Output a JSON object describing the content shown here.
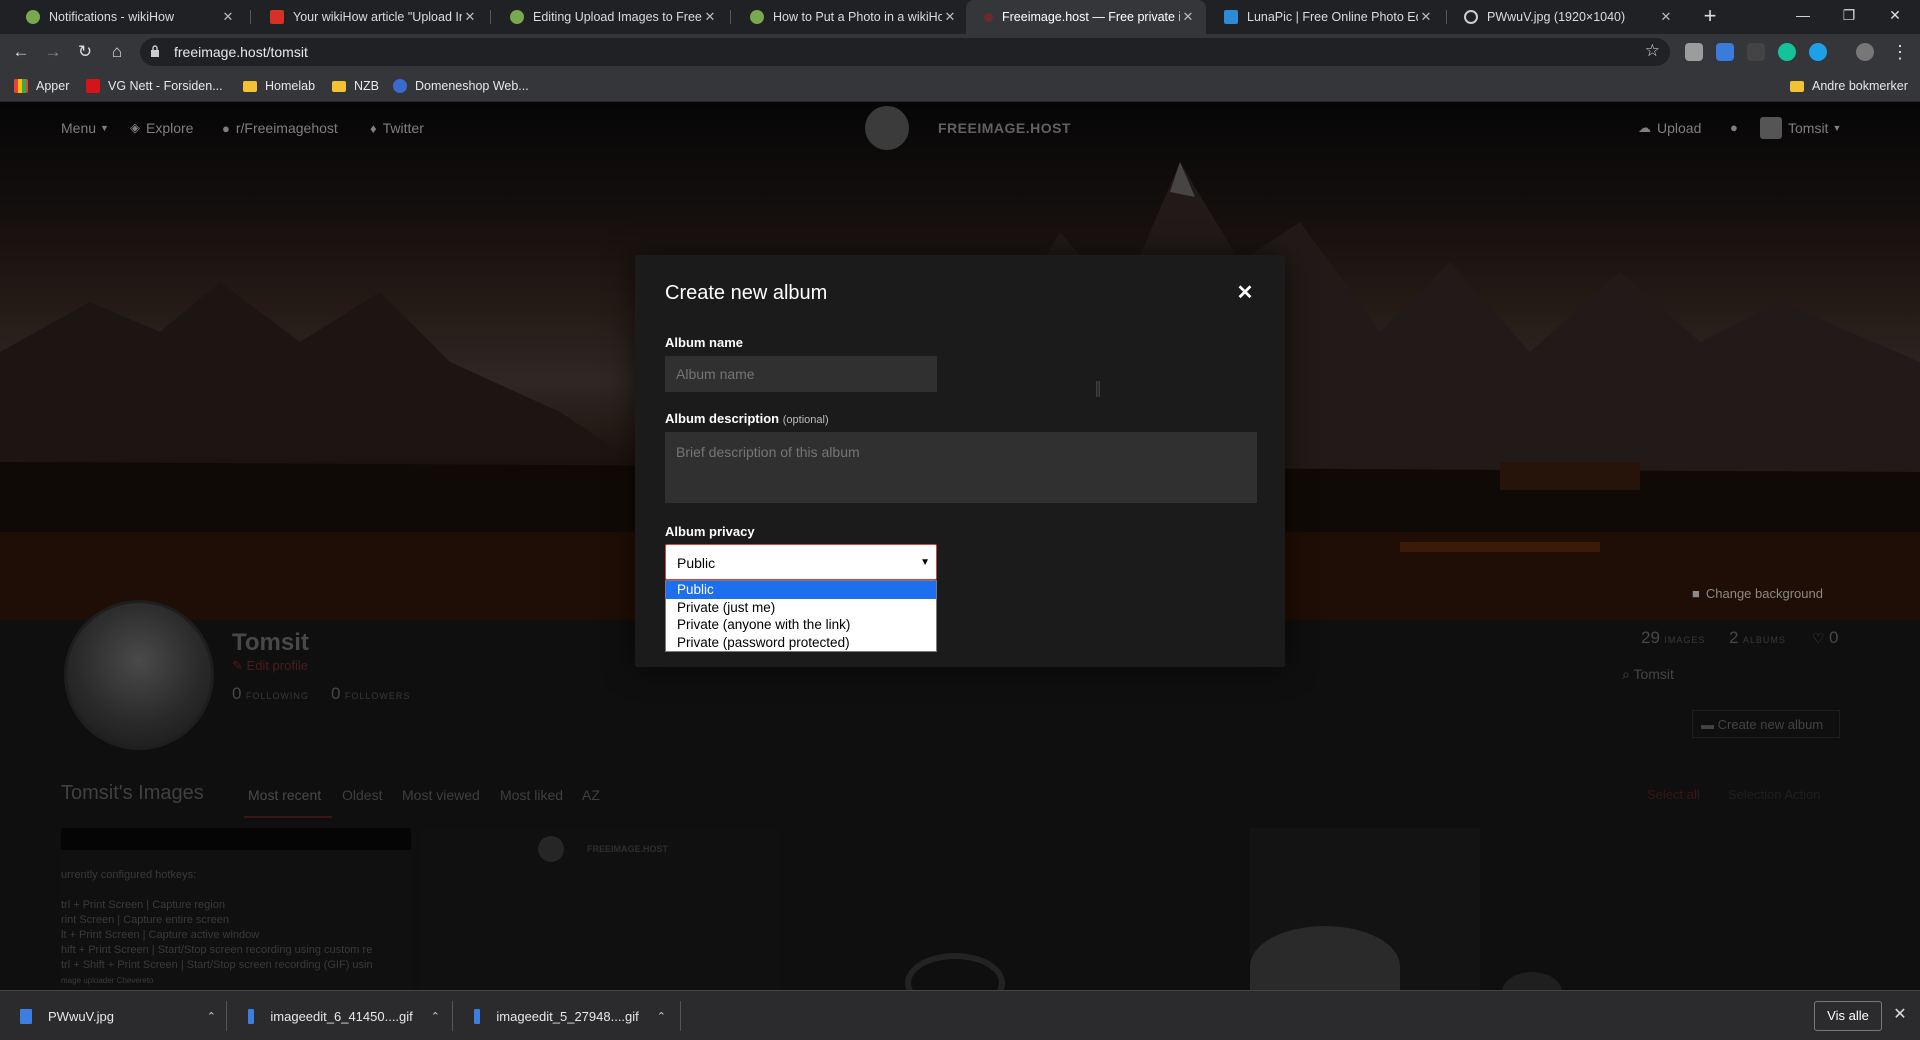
{
  "browser": {
    "tabs": [
      {
        "title": "Notifications - wikiHow",
        "favicon": "wikihow-icon",
        "active": false
      },
      {
        "title": "Your wikiHow article \"Upload Ima",
        "favicon": "gmail-icon",
        "active": false
      },
      {
        "title": "Editing Upload Images to Freeim",
        "favicon": "wikihow-icon",
        "active": false
      },
      {
        "title": "How to Put a Photo in a wikiHow",
        "favicon": "wikihow-icon",
        "active": false
      },
      {
        "title": "Freeimage.host — Free private im",
        "favicon": "freeimage-icon",
        "active": true
      },
      {
        "title": "LunaPic | Free Online Photo Edito",
        "favicon": "lunapic-icon",
        "active": false
      },
      {
        "title": "PWwuV.jpg (1920×1040)",
        "favicon": "globe-icon",
        "active": false
      }
    ],
    "address": "freeimage.host/tomsit",
    "bookmarks": [
      "Apper",
      "VG Nett - Forsiden...",
      "Homelab",
      "NZB",
      "Domeneshop Web..."
    ],
    "other_bookmarks": "Andre bokmerker"
  },
  "site": {
    "nav": {
      "menu": "Menu",
      "explore": "Explore",
      "reddit": "r/Freeimagehost",
      "twitter": "Twitter",
      "upload": "Upload",
      "user": "Tomsit"
    },
    "brand": "FREEIMAGE.HOST",
    "change_background": "Change background"
  },
  "profile": {
    "name": "Tomsit",
    "edit_profile": "Edit profile",
    "following_count": "0",
    "following_label": "FOLLOWING",
    "followers_count": "0",
    "followers_label": "FOLLOWERS",
    "images_count": "29",
    "images_label": "IMAGES",
    "albums_count": "2",
    "albums_label": "ALBUMS",
    "likes_count": "0",
    "search_placeholder": "Tomsit",
    "create_album": "Create new album"
  },
  "gallery": {
    "title": "Tomsit's Images",
    "sort_tabs": [
      "Most recent",
      "Oldest",
      "Most viewed",
      "Most liked",
      "AZ"
    ],
    "select_all": "Select all",
    "selection_action": "Selection Action",
    "thumb_brand": "FREEIMAGE.HOST",
    "thumb_text": [
      "urrently configured hotkeys:",
      "trl + Print Screen  |  Capture region",
      "rint Screen  |  Capture entire screen",
      "lt + Print Screen  |  Capture active window",
      "hift + Print Screen  |  Start/Stop screen recording using custom re",
      "trl + Shift + Print Screen  |  Start/Stop screen recording (GIF) usin",
      "mage uploader Chevereto"
    ]
  },
  "modal": {
    "title": "Create new album",
    "name_label": "Album name",
    "name_placeholder": "Album name",
    "description_label": "Album description",
    "description_optional": "(optional)",
    "description_placeholder": "Brief description of this album",
    "privacy_label": "Album privacy",
    "privacy_selected": "Public",
    "privacy_options": [
      "Public",
      "Private (just me)",
      "Private (anyone with the link)",
      "Private (password protected)"
    ]
  },
  "downloads": {
    "items": [
      "PWwuV.jpg",
      "imageedit_6_41450....gif",
      "imageedit_5_27948....gif"
    ],
    "show_all": "Vis alle"
  },
  "colors": {
    "accent_red": "#c94a41",
    "option_highlight": "#1e6ff0",
    "modal_bg": "#1b1b1b"
  }
}
